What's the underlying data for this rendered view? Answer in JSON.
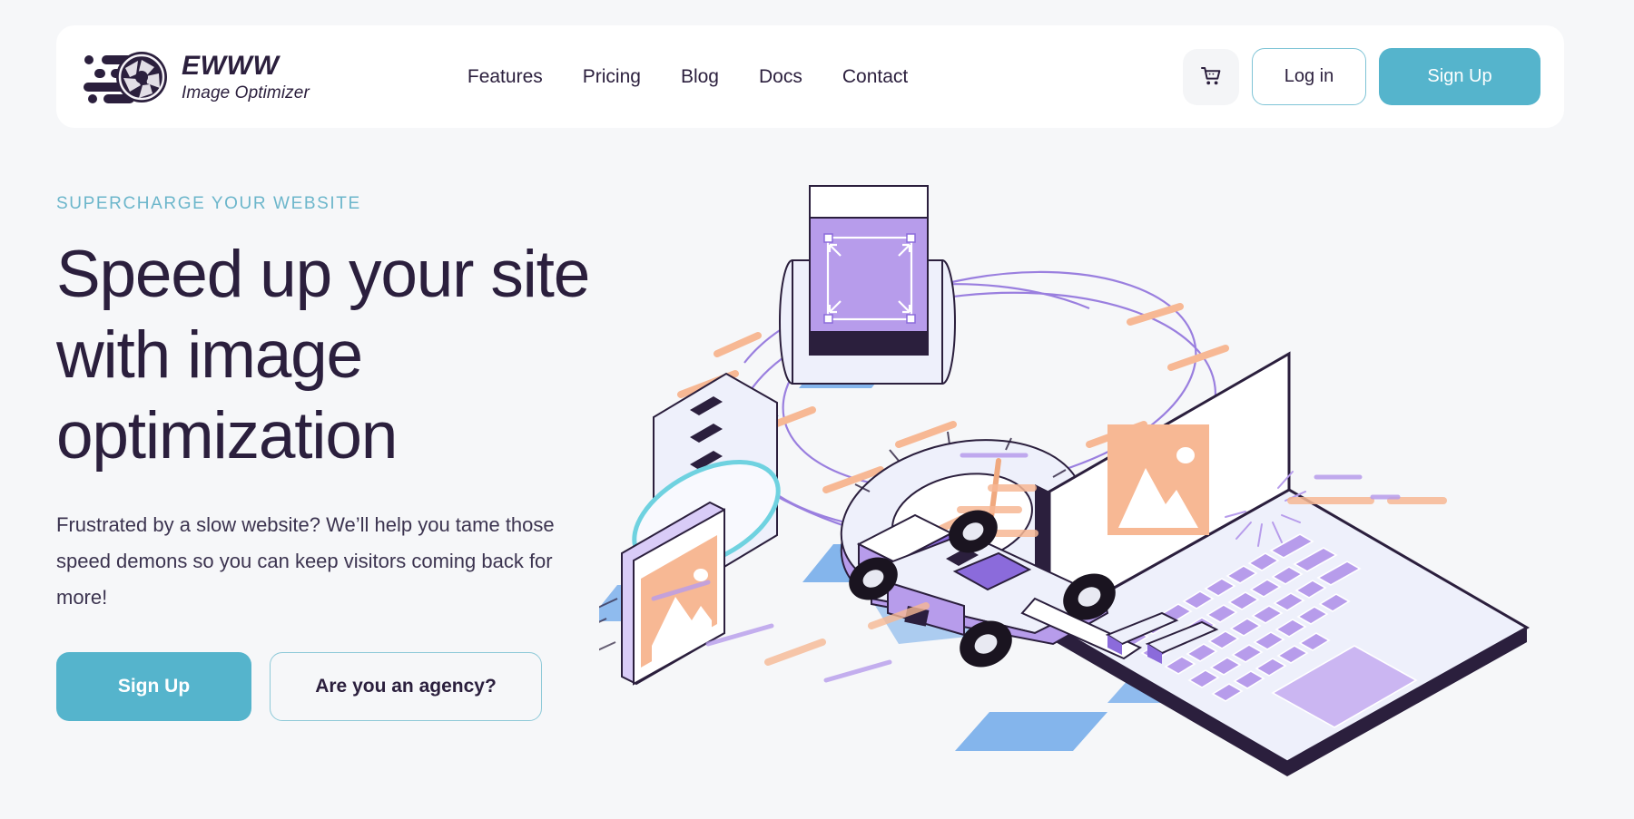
{
  "brand": {
    "name": "EWWW",
    "tagline": "Image Optimizer",
    "logo_icon": "camera-aperture-speed-icon"
  },
  "header": {
    "nav": [
      {
        "label": "Features"
      },
      {
        "label": "Pricing"
      },
      {
        "label": "Blog"
      },
      {
        "label": "Docs"
      },
      {
        "label": "Contact"
      }
    ],
    "cart_icon": "shopping-cart-icon",
    "login_label": "Log in",
    "signup_label": "Sign Up"
  },
  "hero": {
    "eyebrow": "SUPERCHARGE YOUR WEBSITE",
    "headline": "Speed up your site with image optimization",
    "subtitle": "Frustrated by a slow website? We’ll help you tame those speed demons so you can keep visitors coming back for more!",
    "primary_cta": "Sign Up",
    "secondary_cta": "Are you an agency?"
  },
  "illustration": {
    "description": "Isometric scene with laptop showing image placeholder, speedometer dial, compression roller, floating image card, and formula race car"
  },
  "colors": {
    "page_background": "#f6f7f9",
    "card_background": "#ffffff",
    "accent_teal": "#55b4cc",
    "eyebrow_teal": "#6cb6cb",
    "text_dark": "#2b1f3d",
    "text_body": "#3c3450",
    "illustration_purple": "#a98ae6",
    "illustration_purple_dark": "#8b6bdb",
    "illustration_orange": "#f7b894",
    "illustration_blue": "#6fa9ea",
    "illustration_cyan": "#6fd2e0"
  }
}
